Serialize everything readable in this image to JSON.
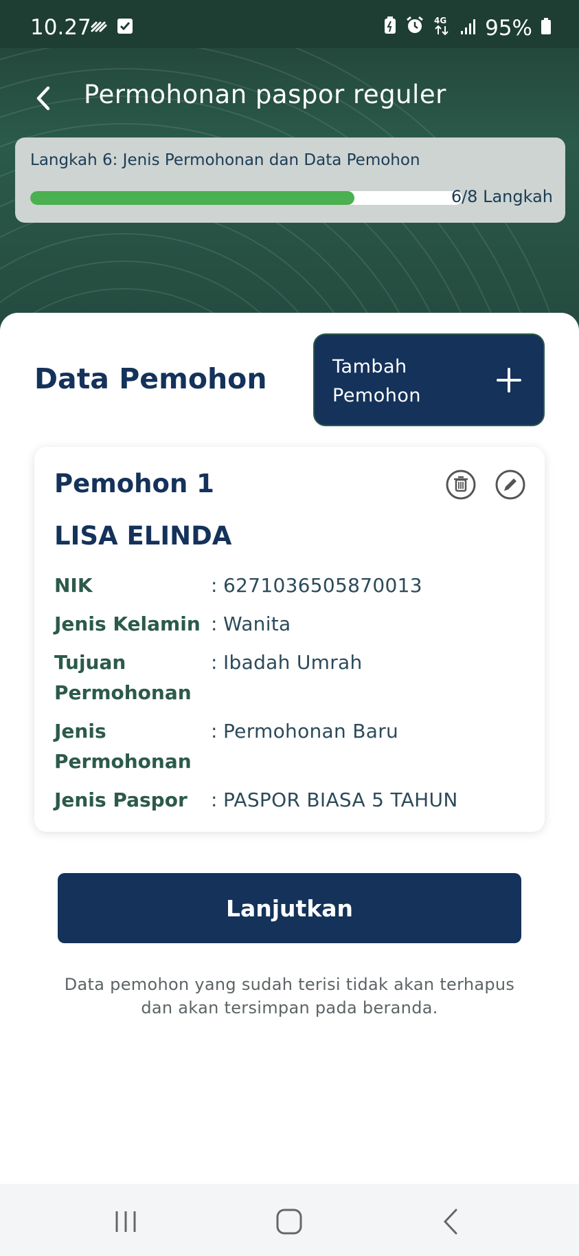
{
  "status_bar": {
    "time": "10.27",
    "battery": "95%",
    "network": "4G"
  },
  "header": {
    "title": "Permohonan paspor reguler",
    "back_icon": "chevron-left-icon"
  },
  "step": {
    "label": "Langkah 6: Jenis Permohonan dan Data Pemohon",
    "progress_fraction": 0.75,
    "progress_label": "6/8 Langkah"
  },
  "main": {
    "section_title": "Data Pemohon",
    "add_button_label": "Tambah Pemohon",
    "applicant": {
      "title": "Pemohon 1",
      "name": "LISA ELINDA",
      "rows": [
        {
          "label": "NIK",
          "value": "6271036505870013"
        },
        {
          "label": "Jenis Kelamin",
          "value": "Wanita"
        },
        {
          "label": "Tujuan Permohonan",
          "value": "Ibadah Umrah"
        },
        {
          "label": "Jenis Permohonan",
          "value": "Permohonan Baru"
        },
        {
          "label": "Jenis Paspor",
          "value": "PASPOR BIASA 5 TAHUN"
        }
      ]
    },
    "continue_label": "Lanjutkan",
    "footnote": "Data pemohon yang sudah terisi tidak akan terhapus dan akan tersimpan pada beranda."
  },
  "colors": {
    "primary": "#14325a",
    "accent_green": "#4bb050",
    "header_green": "#2b5a4a"
  }
}
